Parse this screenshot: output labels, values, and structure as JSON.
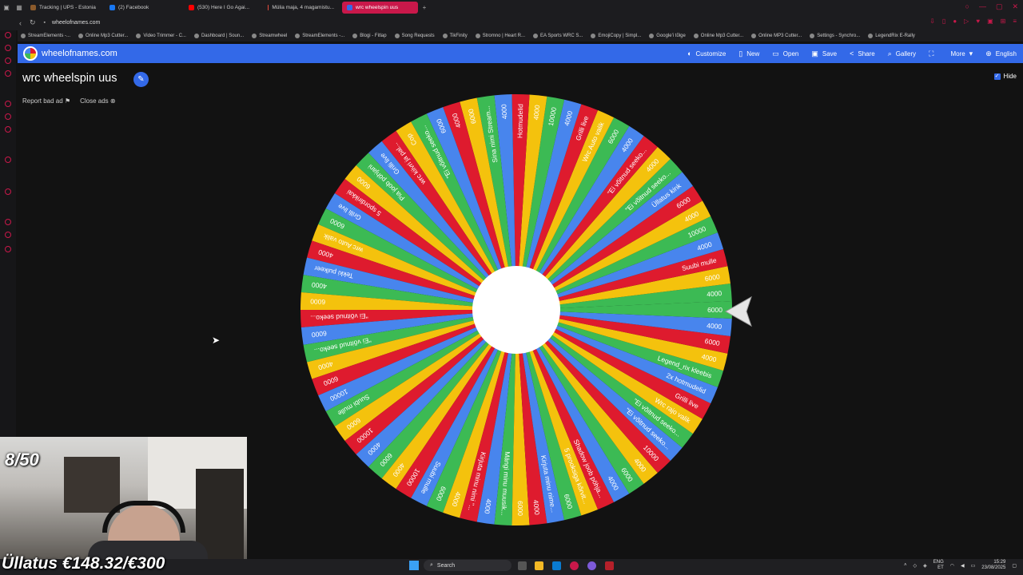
{
  "browser": {
    "tabs": [
      {
        "label": "Tracking | UPS - Estonia",
        "color": "#8b5a2b"
      },
      {
        "label": "(2) Facebook",
        "color": "#1877f2"
      },
      {
        "label": "(530) Here I Go Agai...",
        "color": "#ff0000"
      },
      {
        "label": "Mülia maja, 4 magamistu...",
        "color": "#e84c3d"
      },
      {
        "label": "wrc wheelspin uus",
        "color": "#3369e8",
        "active": true
      }
    ],
    "new_tab": "+",
    "url": "wheelofnames.com",
    "bookmarks": [
      "StreamElements -...",
      "Online Mp3 Cutter...",
      "Video Trimmer - C...",
      "Dashboard | Soun...",
      "Streamwheel",
      "StreamElements -...",
      "Blogi - Fitlap",
      "Song Requests",
      "TikFinity",
      "Stromno | Heart R...",
      "EA Sports WRC S...",
      "EmojiCopy | Simpl...",
      "Google'i tõlge",
      "Online Mp3 Cutter...",
      "Online MP3 Cutter...",
      "Settings - Synchro...",
      "LegendRix E-Rally"
    ]
  },
  "app": {
    "site_name": "wheelofnames.com",
    "menu": [
      {
        "label": "Customize",
        "icon": "palette-icon",
        "glyph": "◐"
      },
      {
        "label": "New",
        "icon": "file-icon",
        "glyph": "▯"
      },
      {
        "label": "Open",
        "icon": "folder-icon",
        "glyph": "▭"
      },
      {
        "label": "Save",
        "icon": "save-icon",
        "glyph": "▣"
      },
      {
        "label": "Share",
        "icon": "share-icon",
        "glyph": "<"
      },
      {
        "label": "Gallery",
        "icon": "search-icon",
        "glyph": "⌕"
      },
      {
        "label": "",
        "icon": "fullscreen-icon",
        "glyph": "⛶"
      },
      {
        "label": "More",
        "icon": "chevron-down-icon",
        "glyph": "▾"
      },
      {
        "label": "English",
        "icon": "globe-icon",
        "glyph": "⊕"
      }
    ],
    "title": "wrc wheelspin uus",
    "report_bad_ad": "Report bad ad",
    "close_ads": "Close ads",
    "hide_label": "Hide",
    "hide_checked": true
  },
  "wheel": {
    "colors": [
      "#3cba54",
      "#f4c20d",
      "#de1b2e",
      "#4885ed"
    ],
    "center_color": "#ffffff",
    "entries": [
      "4000",
      "6000",
      "Suubi mulle",
      "4000",
      "10000",
      "4000",
      "6000",
      "Üllatus kink",
      "\"Ei võitnud seeko...",
      "4000",
      "\"Ei võitnud seeko...",
      "4000",
      "6000",
      "Wrc Auto valik",
      "Grilli live",
      "4000",
      "10000",
      "4000",
      "Hotmudelid",
      "4000",
      "Sina nimi Stream...",
      "6000",
      "4000",
      "6000",
      "\"Ei võitnud seeko...",
      "Cop",
      "wrc kiivri ja pal...",
      "Grilli live",
      "Pia joob pöhjani",
      "6000",
      "5 spordirikkai",
      "Grilli live",
      "6000",
      "wrc Auto valik",
      "4000",
      "Tekki pulkeer",
      "4000",
      "6000",
      "\"Ei võitnud seeko...",
      "6000",
      "\"Ei võitnud seeko...",
      "4000",
      "6000",
      "10000",
      "Suubi mulle",
      "6000",
      "10000",
      "4000",
      "6000",
      "4000",
      "10000",
      "Suubi mulle",
      "6000",
      "4000",
      "Kirjuta minu nimi \"...",
      "4000",
      "Mängi minu muusik...",
      "6000",
      "4000",
      "Kirjuta minu nime...",
      "6000",
      "5 prooksiga kõrvit...",
      "Shadow joob pöhja...",
      "4000",
      "6000",
      "4000",
      "10000",
      "\"Ei võitnud seeko...",
      "\"Ei võitnud seeko...",
      "Wrc rajo valik",
      "Grilli live",
      "2x hotmudelid",
      "Legend_rix kleebis",
      "4000",
      "6000",
      "4000",
      "6000"
    ]
  },
  "stream_overlay": {
    "counter": "8/50",
    "surprise": "Üllatus €148.32/€300"
  },
  "taskbar": {
    "search_placeholder": "Search",
    "lang_top": "ENG",
    "lang_bottom": "ET",
    "time": "15:29",
    "date": "23/08/2025"
  }
}
